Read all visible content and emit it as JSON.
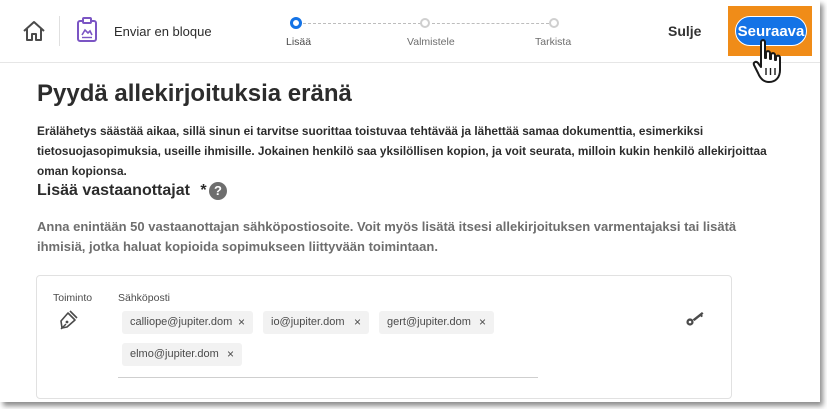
{
  "header": {
    "brand": "Enviar en bloque",
    "steps": [
      {
        "label": "Lisää",
        "active": true
      },
      {
        "label": "Valmistele",
        "active": false
      },
      {
        "label": "Tarkista",
        "active": false
      }
    ],
    "close_label": "Sulje",
    "next_label": "Seuraava",
    "accent_color": "#1473e6",
    "highlight_color": "#f08c18",
    "icons": [
      "home-icon",
      "document-icon",
      "hand-cursor-icon"
    ]
  },
  "main": {
    "title": "Pyydä allekirjoituksia eränä",
    "intro": "Erälähetys säästää aikaa, sillä sinun ei tarvitse suorittaa toistuvaa tehtävää ja lähettää samaa dokumenttia, esimerkiksi tietosuojasopimuksia, useille ihmisille. Jokainen henkilö saa yksilöllisen kopion, ja voit seurata, milloin kukin henkilö allekirjoittaa oman kopionsa.",
    "recipients_heading": "Lisää vastaanottajat",
    "required_marker": "*",
    "help_symbol": "?",
    "recipients_desc": "Anna enintään 50 vastaanottajan sähköpostiosoite. Voit myös lisätä itsesi allekirjoituksen varmentajaksi tai lisätä ihmisiä, jotka haluat kopioida sopimukseen liittyvään toimintaan.",
    "card": {
      "role_header": "Toiminto",
      "email_header": "Sähköposti",
      "remove_symbol": "×",
      "emails": [
        "calliope@jupiter.dom",
        "io@jupiter.dom",
        "gert@jupiter.dom",
        "elmo@jupiter.dom"
      ],
      "icons": [
        "signer-pen-icon",
        "key-icon"
      ]
    }
  }
}
